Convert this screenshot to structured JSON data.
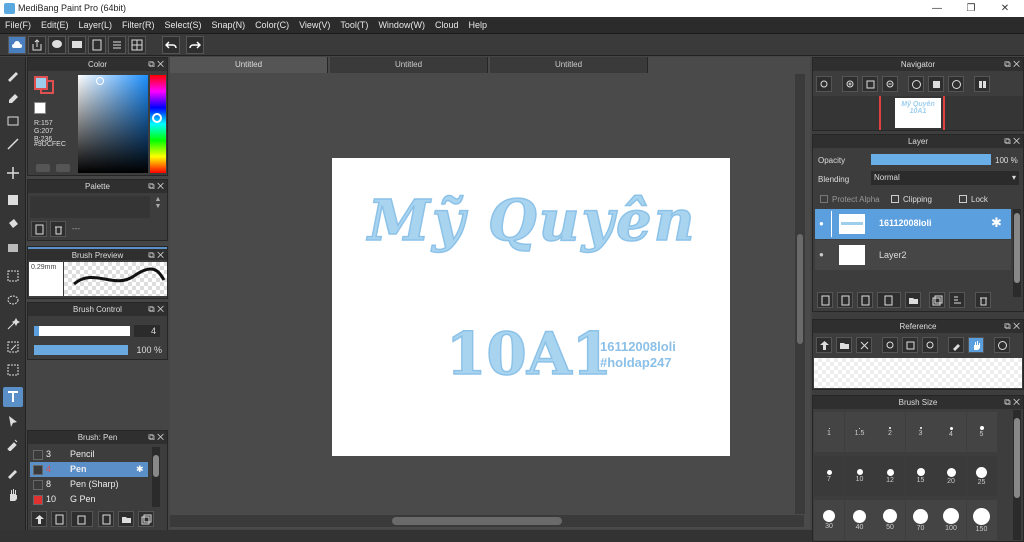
{
  "window": {
    "title": "MediBang Paint Pro (64bit)",
    "minimize": "—",
    "maximize": "❐",
    "close": "✕"
  },
  "menu": [
    "File(F)",
    "Edit(E)",
    "Layer(L)",
    "Filter(R)",
    "Select(S)",
    "Snap(N)",
    "Color(C)",
    "View(V)",
    "Tool(T)",
    "Window(W)",
    "Cloud",
    "Help"
  ],
  "color_panel": {
    "title": "Color",
    "r": "R:157",
    "g": "G:207",
    "b": "B:236",
    "hex": "#9DCFEC",
    "foreground": "#9DCFEC",
    "background": "#ffffff"
  },
  "palette_panel": {
    "title": "Palette",
    "dash": "---"
  },
  "brush_preview_panel": {
    "title": "Brush Preview",
    "size": "0.29mm"
  },
  "brush_control_panel": {
    "title": "Brush Control",
    "size_value": "4",
    "opacity_value": "100 %",
    "size_fraction": 0.05,
    "opacity_fraction": 1.0
  },
  "brush_panel": {
    "title": "Brush: Pen",
    "items": [
      {
        "num": "3",
        "name": "Pencil",
        "color": "#3a3a3a",
        "selected": false
      },
      {
        "num": "4",
        "name": "Pen",
        "color": "#3a3a3a",
        "selected": true
      },
      {
        "num": "8",
        "name": "Pen (Sharp)",
        "color": "#3a3a3a",
        "selected": false
      },
      {
        "num": "10",
        "name": "G Pen",
        "color": "#e03030",
        "selected": false
      }
    ]
  },
  "tabs": [
    "Untitled",
    "Untitled",
    "Untitled"
  ],
  "canvas": {
    "line1": "Mỹ Quyên",
    "line2": "10A1",
    "tag1": "16112008loli",
    "tag2": "#holdap247",
    "ink": "#a9d4f0"
  },
  "navigator": {
    "title": "Navigator",
    "thumb_line1": "Mỹ Quyên",
    "thumb_line2": "10A1"
  },
  "layer_panel": {
    "title": "Layer",
    "opacity_label": "Opacity",
    "opacity_value": "100 %",
    "blending_label": "Blending",
    "blending_value": "Normal",
    "protect_alpha": "Protect Alpha",
    "clipping": "Clipping",
    "lock": "Lock",
    "layers": [
      {
        "name": "16112008loli",
        "selected": true
      },
      {
        "name": "Layer2",
        "selected": false
      }
    ]
  },
  "reference_panel": {
    "title": "Reference"
  },
  "brush_size_panel": {
    "title": "Brush Size",
    "sizes": [
      "1",
      "1.5",
      "2",
      "3",
      "4",
      "5",
      "7",
      "10",
      "12",
      "15",
      "20",
      "25",
      "30",
      "40",
      "50",
      "70",
      "100",
      "150"
    ]
  }
}
